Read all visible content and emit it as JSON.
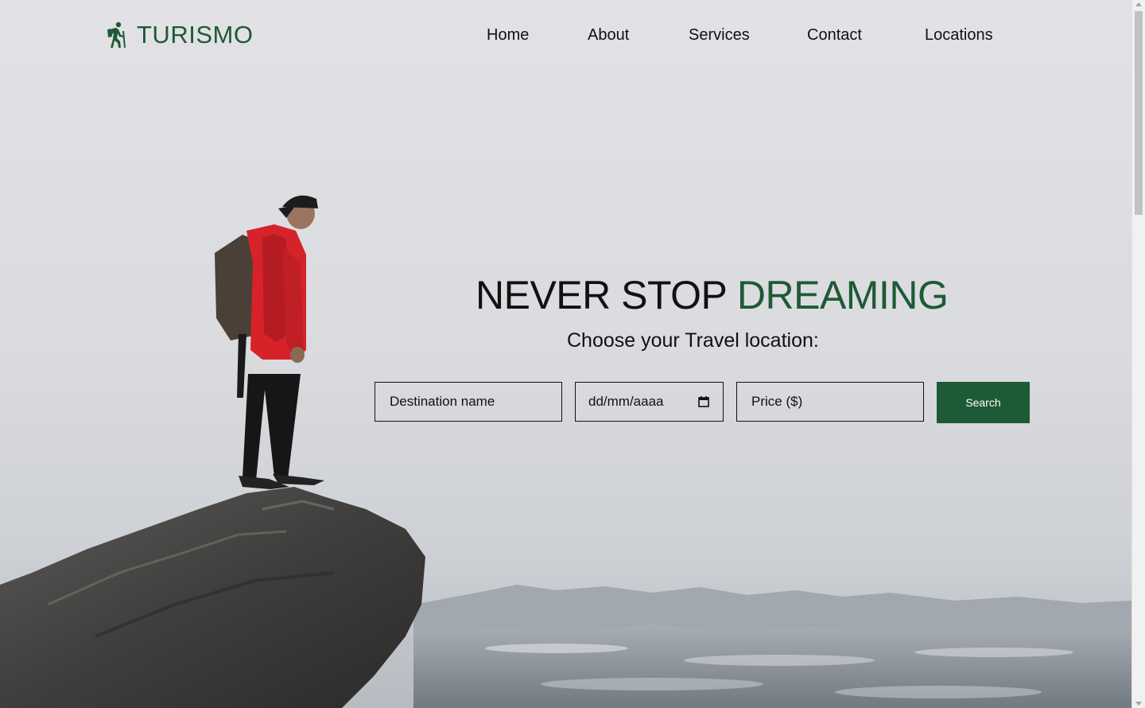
{
  "brand": {
    "name": "TURISMO",
    "icon": "hiker-icon",
    "color": "#1e5a35"
  },
  "nav": {
    "items": [
      {
        "label": "Home"
      },
      {
        "label": "About"
      },
      {
        "label": "Services"
      },
      {
        "label": "Contact"
      },
      {
        "label": "Locations"
      }
    ]
  },
  "hero": {
    "headline_plain": "NEVER STOP",
    "headline_accent": "DREAMING",
    "subtitle": "Choose your Travel location:",
    "background_image": "hiker-on-cliff-photo"
  },
  "search_form": {
    "destination_placeholder": "Destination name",
    "date_placeholder": "dd/mm/aaaa",
    "date_icon": "calendar-icon",
    "price_placeholder": "Price ($)",
    "submit_label": "Search"
  },
  "colors": {
    "accent": "#1e5a35",
    "text": "#111111",
    "button_text": "#ffffff"
  }
}
